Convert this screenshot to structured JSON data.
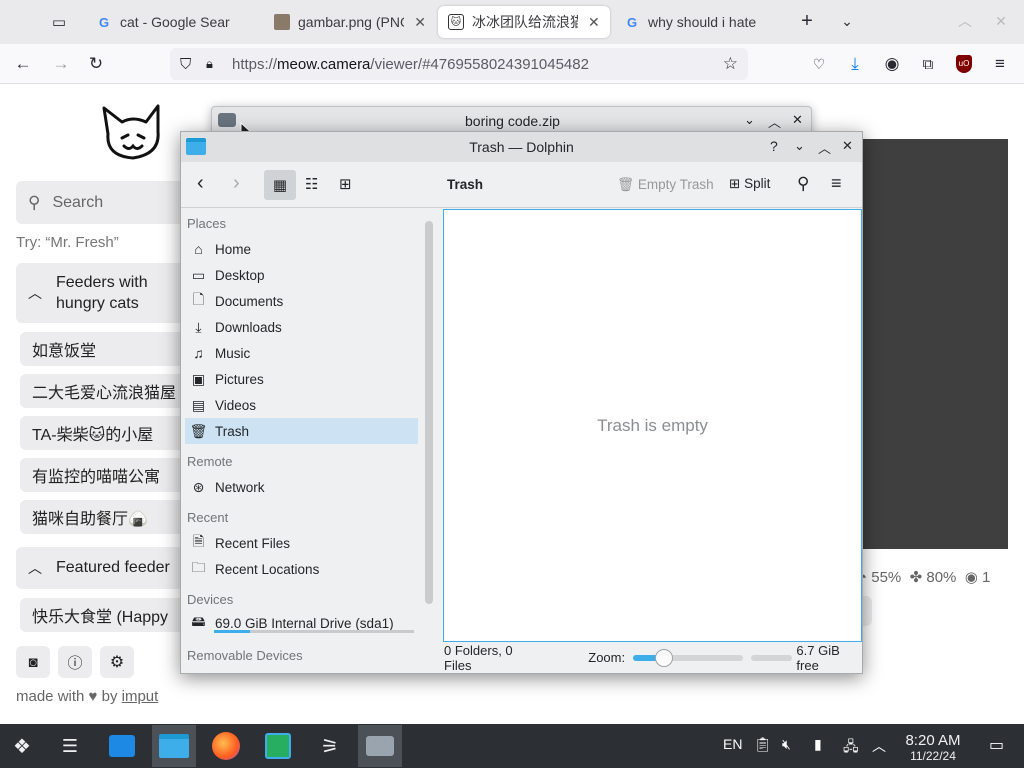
{
  "browser": {
    "tabs": [
      {
        "title": "cat - Google Search",
        "icon": "google-icon"
      },
      {
        "title": "gambar.png (PNG",
        "icon": "image-icon"
      },
      {
        "title": "冰冰团队给流浪猫",
        "icon": "cat-icon"
      },
      {
        "title": "why should i hate",
        "icon": "google-icon"
      }
    ],
    "url_scheme": "https://",
    "url_domain": "meow.camera",
    "url_path": "/viewer/#4769558024391045482"
  },
  "page": {
    "search_placeholder": "Search",
    "try_hint": "Try: “Mr. Fresh”",
    "section1_title": "Feeders with hungry cats",
    "feeders": [
      "如意饭堂",
      "二大毛爱心流浪猫屋",
      "TA-柴柴🐱的小屋",
      "有监控的喵喵公寓",
      "猫咪自助餐厅🍙"
    ],
    "section2_title": "Featured feeder",
    "featured": [
      "快乐大食堂 (Happy"
    ],
    "made_with": "made with",
    "by": "by",
    "author": "imput",
    "stats": {
      "food": "55%",
      "cats": "80%",
      "viewers": "1"
    }
  },
  "zip_window": {
    "title": "boring code.zip"
  },
  "dolphin": {
    "title": "Trash — Dolphin",
    "location": "Trash",
    "empty_trash": "Empty Trash",
    "split": "Split",
    "groups": {
      "places": "Places",
      "remote": "Remote",
      "recent": "Recent",
      "devices": "Devices",
      "removable": "Removable Devices"
    },
    "places": [
      "Home",
      "Desktop",
      "Documents",
      "Downloads",
      "Music",
      "Pictures",
      "Videos",
      "Trash"
    ],
    "remote": [
      "Network"
    ],
    "recent": [
      "Recent Files",
      "Recent Locations"
    ],
    "device": "69.0 GiB Internal Drive (sda1)",
    "device_usage": 0.18,
    "empty_message": "Trash is empty",
    "status_counts": "0 Folders, 0 Files",
    "zoom_label": "Zoom:",
    "zoom_level": 0.28,
    "free_space": "6.7 GiB free"
  },
  "taskbar": {
    "lang": "EN",
    "time": "8:20 AM",
    "date": "11/22/24"
  },
  "colors": {
    "accent": "#3daee9",
    "selection": "#cde3f3",
    "panel": "#2c3035"
  }
}
